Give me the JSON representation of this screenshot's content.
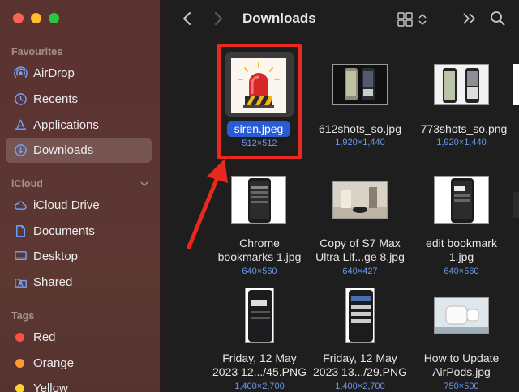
{
  "window": {
    "title": "Downloads"
  },
  "sidebar": {
    "favourites_title": "Favourites",
    "favourites": [
      {
        "label": "AirDrop",
        "icon": "airdrop-icon"
      },
      {
        "label": "Recents",
        "icon": "clock-icon"
      },
      {
        "label": "Applications",
        "icon": "applications-icon"
      },
      {
        "label": "Downloads",
        "icon": "download-icon",
        "active": true
      }
    ],
    "icloud_title": "iCloud",
    "icloud": [
      {
        "label": "iCloud Drive",
        "icon": "cloud-icon"
      },
      {
        "label": "Documents",
        "icon": "document-icon"
      },
      {
        "label": "Desktop",
        "icon": "desktop-icon"
      },
      {
        "label": "Shared",
        "icon": "shared-folder-icon"
      }
    ],
    "tags_title": "Tags",
    "tags": [
      {
        "label": "Red",
        "color": "#ff4f45"
      },
      {
        "label": "Orange",
        "color": "#ff9a2e"
      },
      {
        "label": "Yellow",
        "color": "#ffd233"
      }
    ]
  },
  "files": [
    {
      "name": "siren.jpeg",
      "dims": "512×512"
    },
    {
      "name": "612shots_so.jpg",
      "dims": "1,920×1,440"
    },
    {
      "name": "773shots_so.png",
      "dims": "1,920×1,440"
    },
    {
      "name_line1": "Chrome",
      "name_line2": "bookmarks 1.jpg",
      "dims": "640×560"
    },
    {
      "name_line1": "Copy of S7 Max",
      "name_line2": "Ultra Lif...ge 8.jpg",
      "dims": "640×427"
    },
    {
      "name_line1": "edit bookmark",
      "name_line2": "1.jpg",
      "dims": "640×560"
    },
    {
      "name_line1": "Friday, 12 May",
      "name_line2": "2023 12.../45.PNG",
      "dims": "1,400×2,700"
    },
    {
      "name_line1": "Friday, 12 May",
      "name_line2": "2023 13.../29.PNG",
      "dims": "1,400×2,700"
    },
    {
      "name_line1": "How to Update",
      "name_line2": "AirPods.jpg",
      "dims": "750×500"
    }
  ],
  "colors": {
    "selection": "#2a5bd7",
    "highlight_box": "#e8291f",
    "dim_text": "#6a97e8"
  }
}
